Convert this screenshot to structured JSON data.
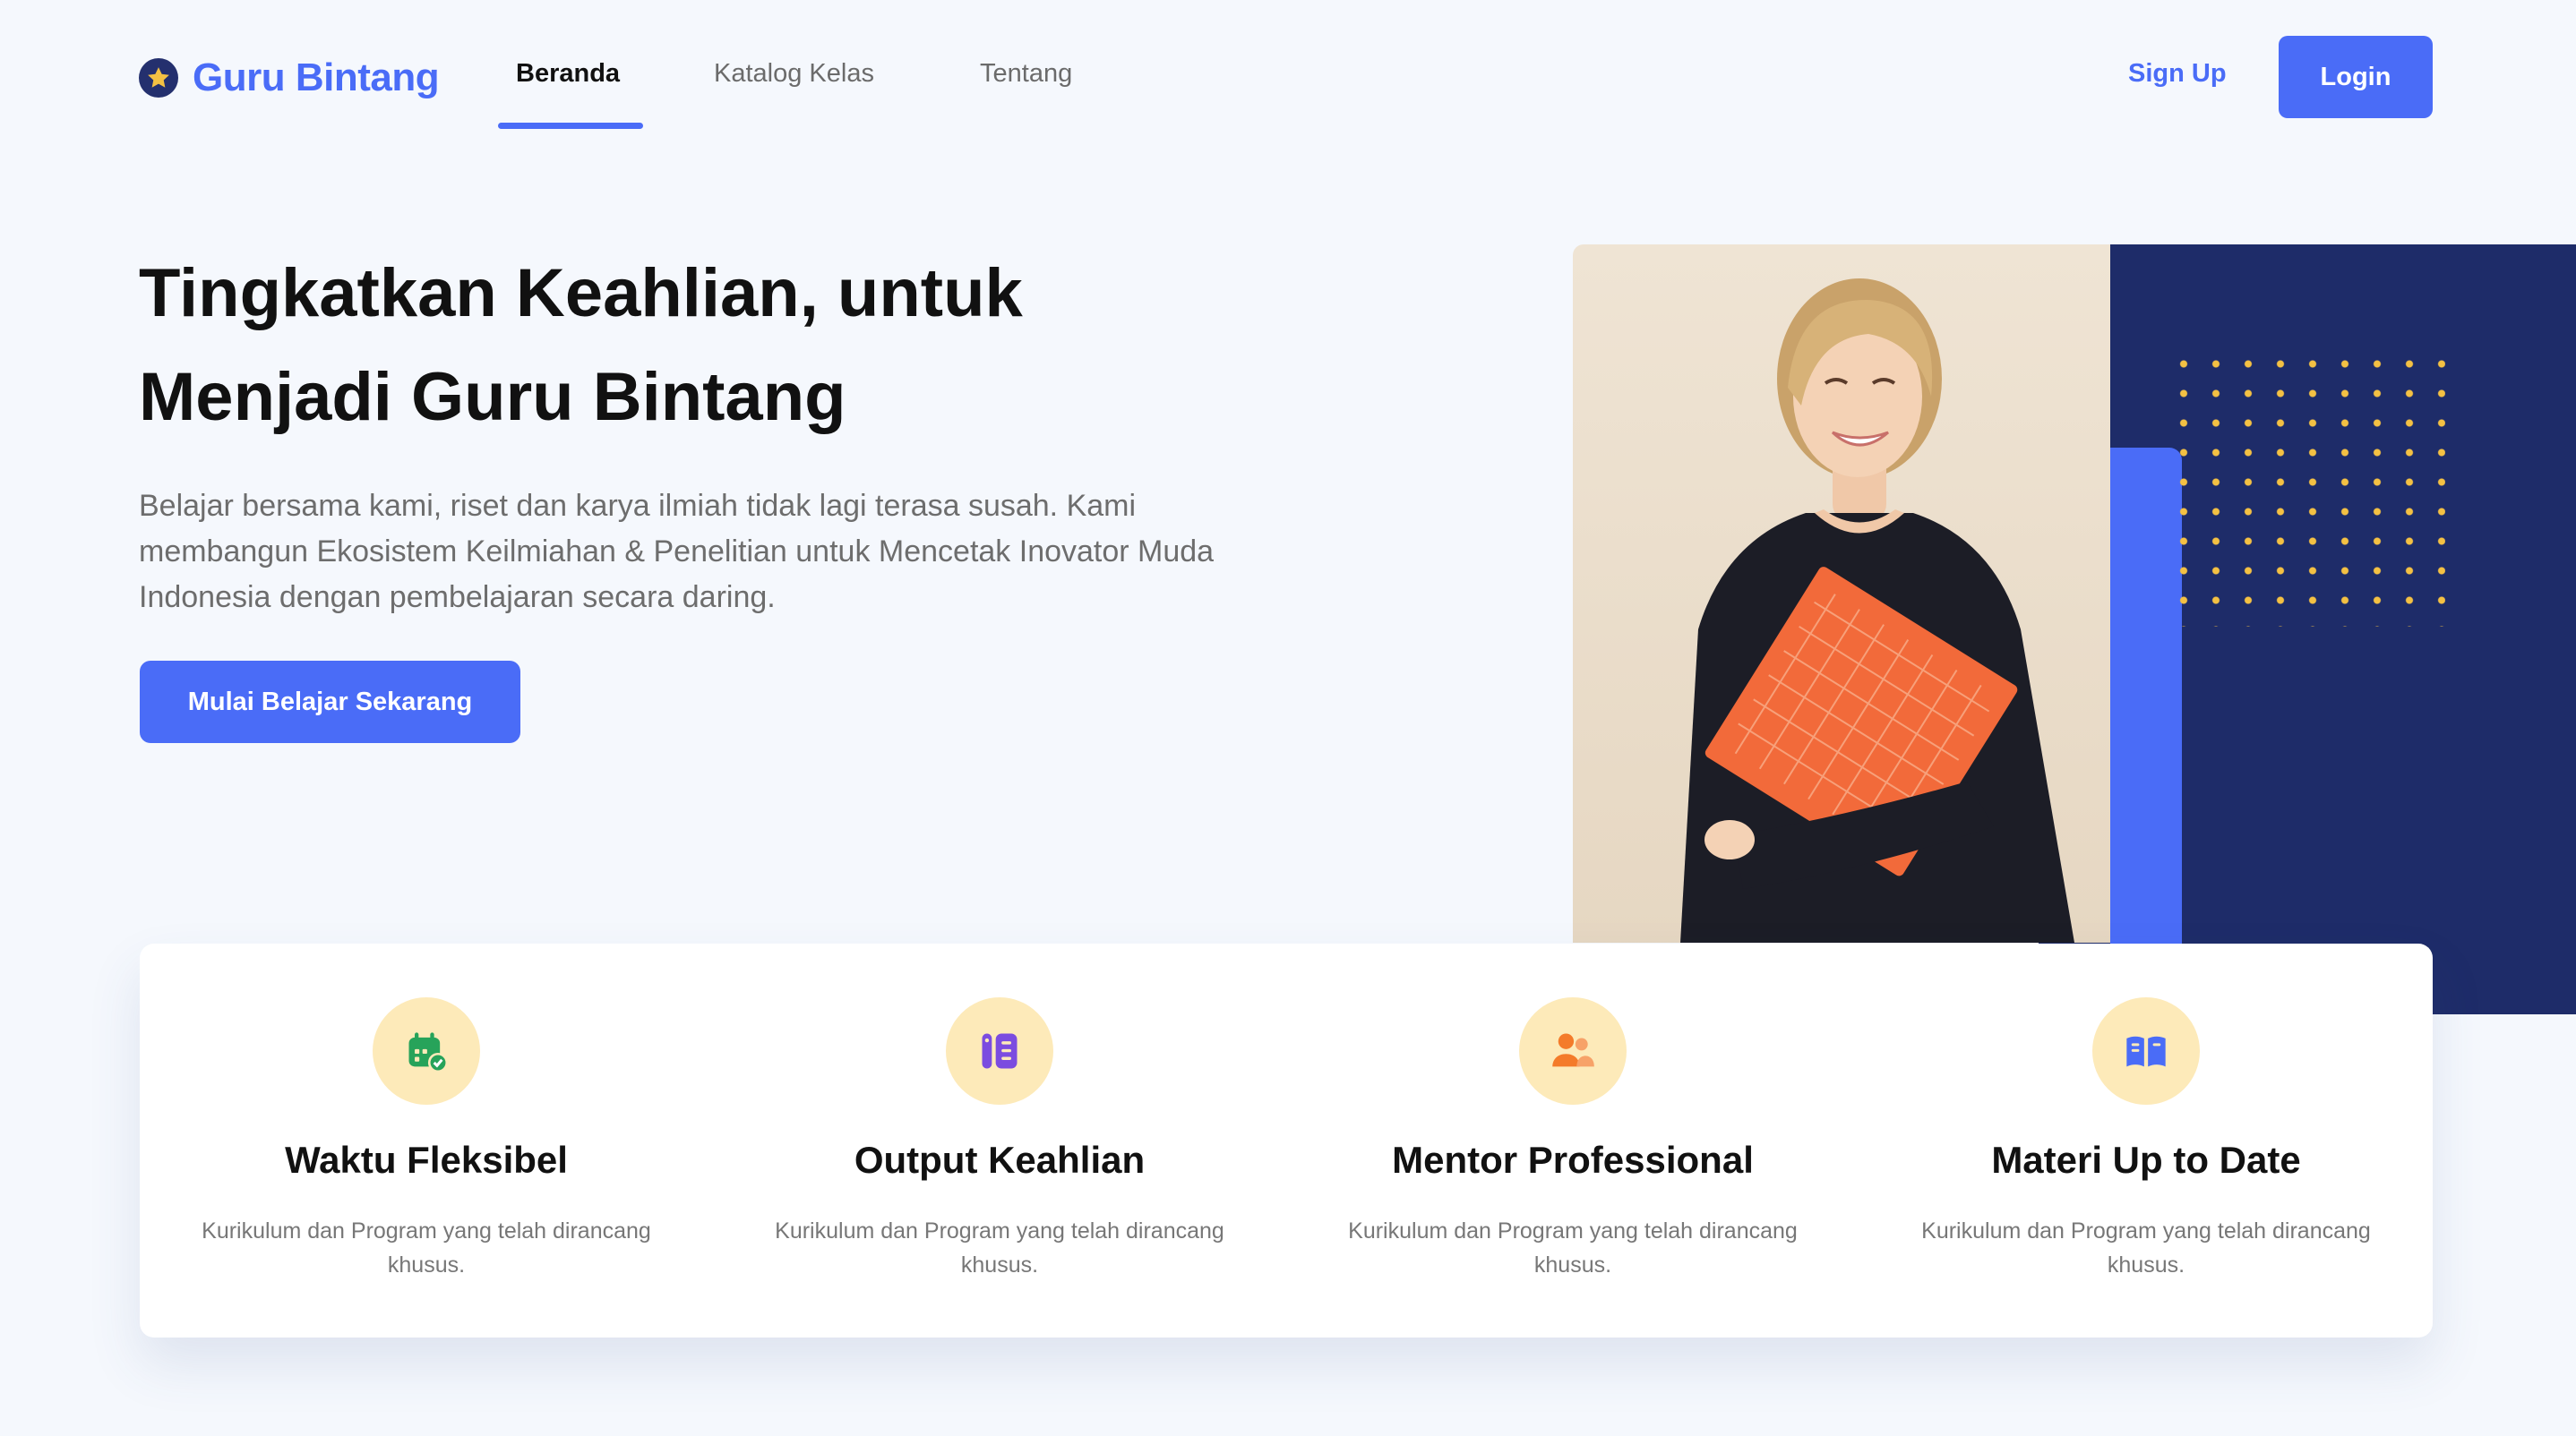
{
  "brand": {
    "name": "Guru Bintang",
    "icon": "star-icon",
    "color": "#4a6cf7"
  },
  "nav": {
    "links": [
      {
        "label": "Beranda",
        "active": true
      },
      {
        "label": "Katalog Kelas",
        "active": false
      },
      {
        "label": "Tentang",
        "active": false
      }
    ],
    "signup_label": "Sign Up",
    "login_label": "Login"
  },
  "hero": {
    "title_line1": "Tingkatkan Keahlian, untuk",
    "title_line2": "Menjadi Guru Bintang",
    "description": "Belajar bersama kami, riset dan karya ilmiah tidak lagi terasa susah. Kami membangun Ekosistem Keilmiahan & Penelitian untuk Mencetak Inovator Muda Indonesia dengan pembelajaran secara daring.",
    "cta_label": "Mulai Belajar Sekarang",
    "image": "smiling-woman-holding-orange-folder"
  },
  "features": [
    {
      "icon": "calendar-check-icon",
      "icon_color": "#27a35a",
      "title": "Waktu Fleksibel",
      "desc": "Kurikulum dan Program yang telah dirancang khusus."
    },
    {
      "icon": "notebook-icon",
      "icon_color": "#7b4ce0",
      "title": "Output Keahlian",
      "desc": "Kurikulum dan Program yang telah dirancang khusus."
    },
    {
      "icon": "users-icon",
      "icon_color": "#f47b2a",
      "title": "Mentor Professional",
      "desc": "Kurikulum dan Program yang telah dirancang khusus."
    },
    {
      "icon": "open-book-icon",
      "icon_color": "#4a6cf7",
      "title": "Materi Up to Date",
      "desc": "Kurikulum dan Program yang telah dirancang khusus."
    }
  ],
  "colors": {
    "primary": "#4a6cf7",
    "navy": "#1e2c69",
    "accent_yellow": "#f4c143",
    "icon_bg": "#fdeab9",
    "background": "#f5f8fd"
  }
}
